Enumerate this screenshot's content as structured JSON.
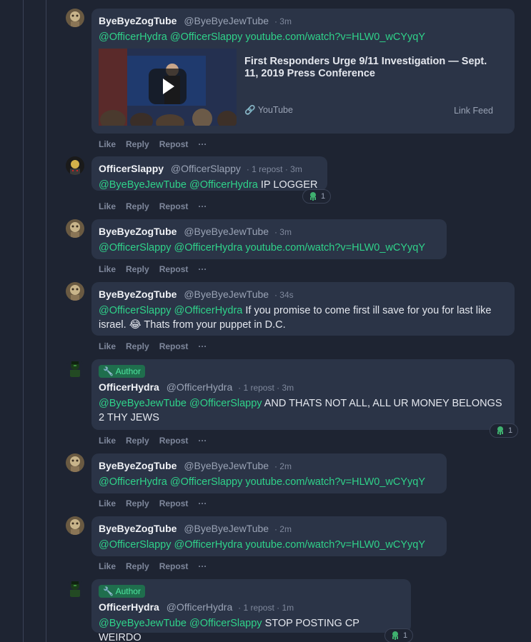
{
  "users": {
    "bbzt": {
      "name": "ByeByeZogTube",
      "handle": "@ByeByeJewTube"
    },
    "hydra": {
      "name": "OfficerHydra",
      "handle": "@OfficerHydra"
    },
    "slappy": {
      "name": "OfficerSlappy",
      "handle": "@OfficerSlappy"
    }
  },
  "actions": {
    "like": "Like",
    "reply": "Reply",
    "repost": "Repost",
    "more": "···"
  },
  "author_badge": "Author",
  "embed": {
    "title": "First Responders Urge 9/11 Investigation — Sept. 11, 2019 Press Conference",
    "source": "YouTube",
    "feed": "Link Feed"
  },
  "comments": [
    {
      "meta": "· 3m",
      "m1": "@OfficerHydra",
      "m2": "@OfficerSlappy",
      "link": "youtube.com/watch?v=HLW0_wCYyqY"
    },
    {
      "meta": "· 1 repost · 3m",
      "m1": "@ByeByeJewTube",
      "m2": "@OfficerHydra",
      "text": "IP LOGGER",
      "reaction": "1"
    },
    {
      "meta": "· 3m",
      "m1": "@OfficerSlappy",
      "m2": "@OfficerHydra",
      "link": "youtube.com/watch?v=HLW0_wCYyqY"
    },
    {
      "meta": "· 34s",
      "m1": "@OfficerSlappy",
      "m2": "@OfficerHydra",
      "text": "If you promise to come first ill save for you for last like israel. 😂 Thats from your puppet in D.C."
    },
    {
      "meta": "· 1 repost · 3m",
      "m1": "@ByeByeJewTube",
      "m2": "@OfficerSlappy",
      "text": "AND THATS NOT ALL, ALL UR MONEY BELONGS 2 THY JEWS",
      "reaction": "1"
    },
    {
      "meta": "· 2m",
      "m1": "@OfficerHydra",
      "m2": "@OfficerSlappy",
      "link": "youtube.com/watch?v=HLW0_wCYyqY"
    },
    {
      "meta": "· 2m",
      "m1": "@OfficerSlappy",
      "m2": "@OfficerHydra",
      "link": "youtube.com/watch?v=HLW0_wCYyqY"
    },
    {
      "meta": "· 1 repost · 1m",
      "m1": "@ByeByeJewTube",
      "m2": "@OfficerSlappy",
      "text": "STOP POSTING CP WEIRDO",
      "reaction": "1"
    }
  ],
  "colors": {
    "background": "#1e2432",
    "bubble": "#2b3447",
    "mention": "#2fd28a",
    "badge_bg": "#1f6e4d"
  },
  "icons": {
    "play": "play-icon",
    "link": "link-icon",
    "reaction": "squid-reaction-icon",
    "badge": "wrench-icon"
  }
}
